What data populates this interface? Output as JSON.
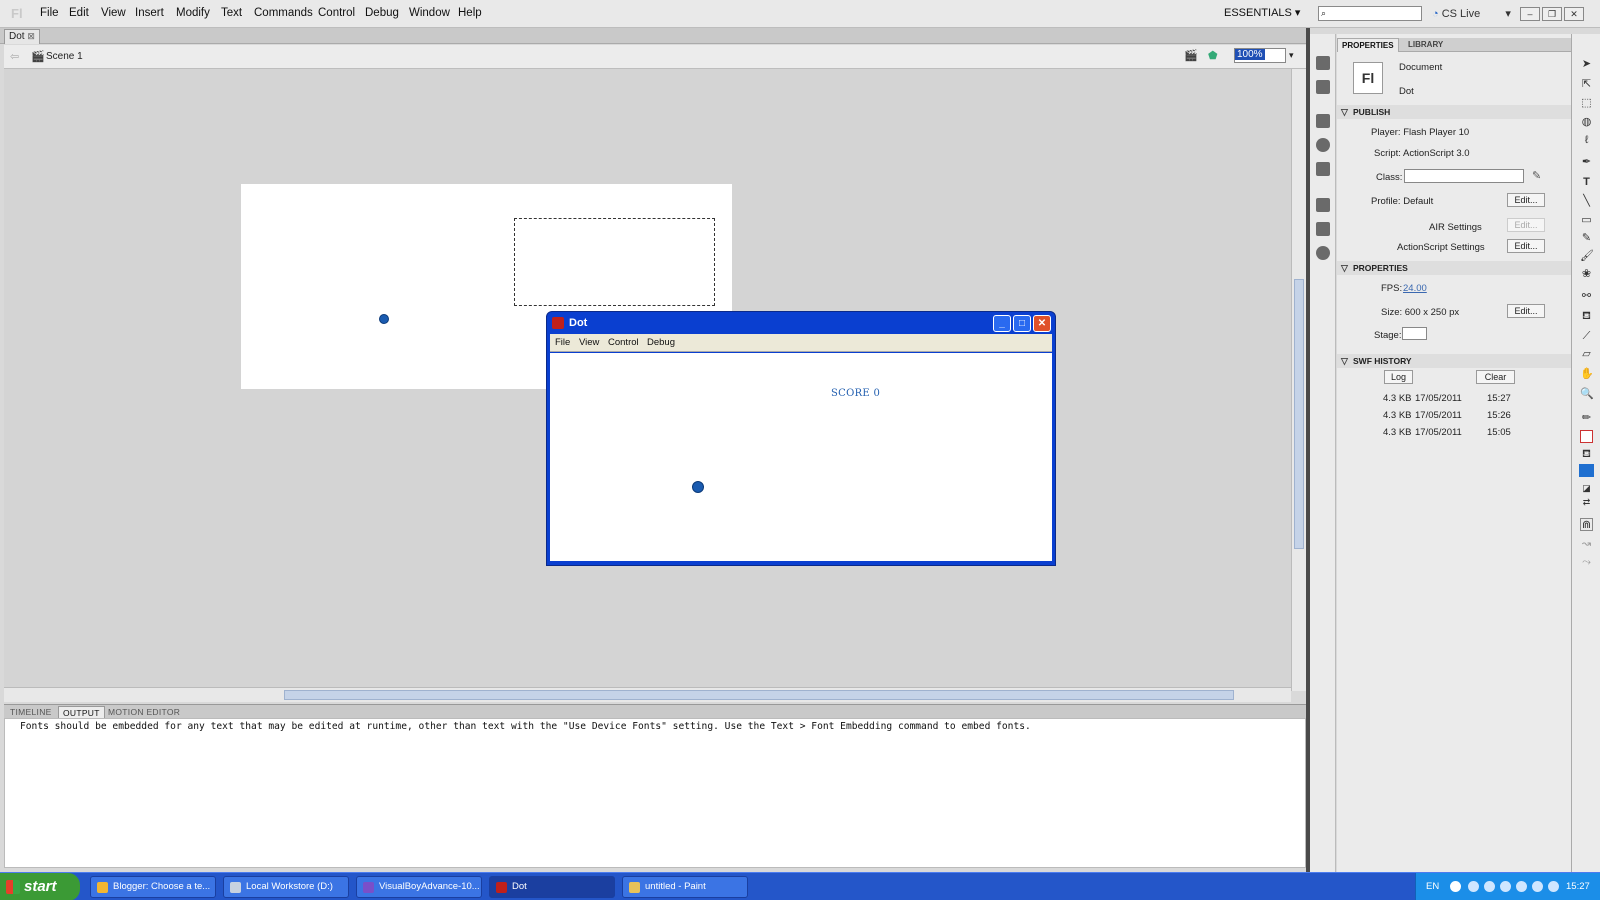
{
  "app": {
    "logo": "Fl"
  },
  "menu": [
    "File",
    "Edit",
    "View",
    "Insert",
    "Modify",
    "Text",
    "Commands",
    "Control",
    "Debug",
    "Window",
    "Help"
  ],
  "workspace": {
    "label": "ESSENTIALS",
    "cslive": "CS Live"
  },
  "document": {
    "tab": "Dot",
    "scene": "Scene 1",
    "zoom": "100%"
  },
  "output_panel": {
    "tabs": [
      "TIMELINE",
      "OUTPUT",
      "MOTION EDITOR"
    ],
    "text": "Fonts should be embedded for any text that may be edited at runtime, other than text with the \"Use Device Fonts\" setting. Use the Text > Font Embedding command to embed fonts."
  },
  "properties": {
    "tabs": [
      "PROPERTIES",
      "LIBRARY"
    ],
    "doc_icon": "Fl",
    "doc_type": "Document",
    "doc_name": "Dot",
    "publish": {
      "header": "PUBLISH",
      "player": "Player: Flash Player 10",
      "script": "Script: ActionScript 3.0",
      "class_label": "Class:",
      "profile": "Profile: Default",
      "edit": "Edit...",
      "air_settings": "AIR Settings",
      "as_settings": "ActionScript Settings"
    },
    "props": {
      "header": "PROPERTIES",
      "fps_label": "FPS:",
      "fps_value": "24.00",
      "size": "Size: 600 x 250 px",
      "stage_label": "Stage:"
    },
    "swf_history": {
      "header": "SWF HISTORY",
      "log": "Log",
      "clear": "Clear",
      "rows": [
        {
          "size": "4.3 KB",
          "date": "17/05/2011",
          "time": "15:27"
        },
        {
          "size": "4.3 KB",
          "date": "17/05/2011",
          "time": "15:26"
        },
        {
          "size": "4.3 KB",
          "date": "17/05/2011",
          "time": "15:05"
        }
      ]
    }
  },
  "player_window": {
    "title": "Dot",
    "menu": [
      "File",
      "View",
      "Control",
      "Debug"
    ],
    "score": "SCORE 0"
  },
  "taskbar": {
    "start": "start",
    "tasks": [
      {
        "label": "Blogger: Choose a te...",
        "icon_color": "#f2b632"
      },
      {
        "label": "Local Workstore (D:)",
        "icon_color": "#c8d2e0"
      },
      {
        "label": "VisualBoyAdvance-10...",
        "icon_color": "#7a4fc9"
      },
      {
        "label": "Dot",
        "icon_color": "#c0201a"
      },
      {
        "label": "untitled - Paint",
        "icon_color": "#e8c25a"
      }
    ],
    "lang": "EN",
    "clock": "15:27"
  },
  "colors": {
    "accent": "#1f4fb5",
    "dot": "#1a5bb0",
    "taskbar": "#2456c9",
    "start": "#3b9a35"
  }
}
